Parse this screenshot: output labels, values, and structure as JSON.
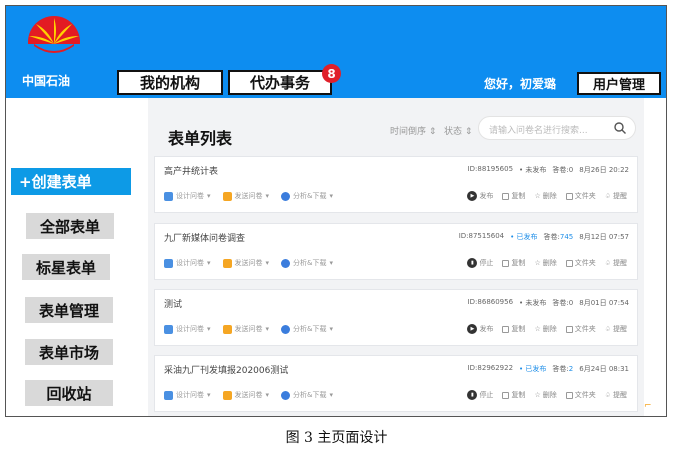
{
  "header": {
    "logo_text": "中国石油",
    "nav_org": "我的机构",
    "nav_todo": "代办事务",
    "todo_badge": "8",
    "greeting": "您好，初爱璐",
    "user_mgmt": "用户管理",
    "brand_color": "#0d8df0"
  },
  "sidebar": {
    "create": "+创建表单",
    "all": "全部表单",
    "starred": "标星表单",
    "manage": "表单管理",
    "market": "表单市场",
    "recycle": "回收站"
  },
  "main": {
    "title": "表单列表",
    "sort_time": "时间倒序 ⇕",
    "sort_status": "状态 ⇕",
    "search_placeholder": "请输入问卷名进行搜索...",
    "tools": {
      "design": "设计问卷",
      "send": "发送问卷",
      "analyze": "分析&下载"
    },
    "actions": {
      "copy": "复制",
      "delete": "删除",
      "folder": "文件夹",
      "remind": "提醒"
    },
    "cards": [
      {
        "name": "高产井统计表",
        "id": "ID:88195605",
        "status": "• 未发布",
        "count_label": "答卷:",
        "count": "0",
        "date": "8月26日 20:22",
        "action": "发布"
      },
      {
        "name": "九厂新媒体问卷调查",
        "id": "ID:87515604",
        "status": "• 已发布",
        "count_label": "答卷:",
        "count": "745",
        "date": "8月12日 07:57",
        "action": "停止"
      },
      {
        "name": "测试",
        "id": "ID:86860956",
        "status": "• 未发布",
        "count_label": "答卷:",
        "count": "0",
        "date": "8月01日 07:54",
        "action": "发布"
      },
      {
        "name": "采油九厂刊发填报202006测试",
        "id": "ID:82962922",
        "status": "• 已发布",
        "count_label": "答卷:",
        "count": "2",
        "date": "6月24日 08:31",
        "action": "停止"
      }
    ]
  },
  "caption": "图 3  主页面设计"
}
